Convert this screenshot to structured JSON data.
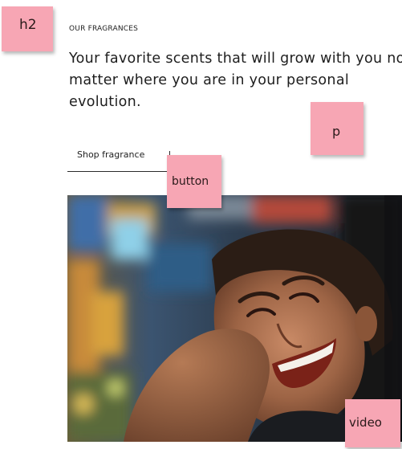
{
  "section": {
    "eyebrow": "OUR FRAGRANCES",
    "headline": "Your favorite scents that will grow with you no matter where you are in your personal evolution.",
    "button_label": "Shop fragrance"
  },
  "annotations": {
    "h2": "h2",
    "p": "p",
    "button": "button",
    "video": "video"
  },
  "colors": {
    "sticky_note": "#f7a6b4",
    "text": "#1e1e1e",
    "button_border": "#2a2a2a"
  }
}
